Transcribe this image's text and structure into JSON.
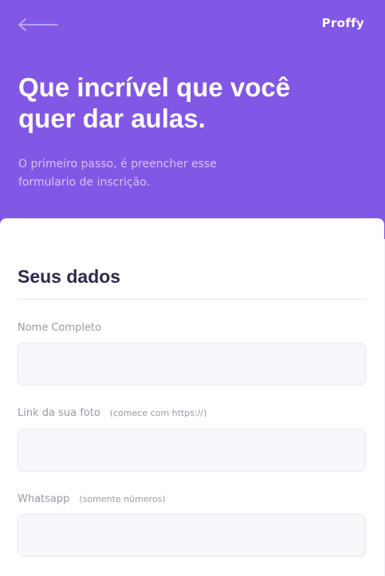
{
  "header": {
    "logo": "Proffy",
    "title": "Que incrível que você quer dar aulas.",
    "subtitle": "O primeiro passo, é preencher esse formulario de inscrição."
  },
  "icons": {
    "back": "arrow-left-icon"
  },
  "form": {
    "section_title": "Seus dados",
    "fields": [
      {
        "label": "Nome Completo",
        "hint": "",
        "value": ""
      },
      {
        "label": "Link da sua foto",
        "hint": "(comece com https://)",
        "value": ""
      },
      {
        "label": "Whatsapp",
        "hint": "(somente números)",
        "value": ""
      }
    ]
  },
  "colors": {
    "primary": "#8257e5",
    "title_text": "#32264d",
    "label_text": "#9c98a6",
    "input_bg": "#f8f8fc",
    "input_border": "#e6e6f0"
  }
}
